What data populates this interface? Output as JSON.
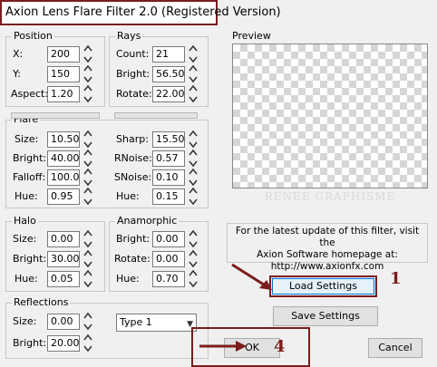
{
  "window": {
    "title": "Axion Lens Flare Filter 2.0 (Registered Version)"
  },
  "position": {
    "legend": "Position",
    "x_label": "X:",
    "x_value": "200",
    "y_label": "Y:",
    "y_value": "150",
    "aspect_label": "Aspect:",
    "aspect_value": "1.20"
  },
  "rays": {
    "legend": "Rays",
    "count_label": "Count:",
    "count_value": "21",
    "bright_label": "Bright:",
    "bright_value": "56.50",
    "rotate_label": "Rotate:",
    "rotate_value": "22.00"
  },
  "preview": {
    "legend": "Preview",
    "watermark": "RENEE GRAPHISME"
  },
  "flare": {
    "legend": "Flare",
    "size_label": "Size:",
    "size_value": "10.50",
    "bright_label": "Bright:",
    "bright_value": "40.00",
    "falloff_label": "Falloff:",
    "falloff_value": "100.00",
    "hue_label": "Hue:",
    "hue_value": "0.95",
    "sharp_label": "Sharp:",
    "sharp_value": "15.50",
    "rnoise_label": "RNoise:",
    "rnoise_value": "0.57",
    "snoise_label": "SNoise:",
    "snoise_value": "0.10",
    "hue2_label": "Hue:",
    "hue2_value": "0.15"
  },
  "halo": {
    "legend": "Halo",
    "size_label": "Size:",
    "size_value": "0.00",
    "bright_label": "Bright:",
    "bright_value": "30.00",
    "hue_label": "Hue:",
    "hue_value": "0.05"
  },
  "anamorphic": {
    "legend": "Anamorphic",
    "bright_label": "Bright:",
    "bright_value": "0.00",
    "rotate_label": "Rotate:",
    "rotate_value": "0.00",
    "hue_label": "Hue:",
    "hue_value": "0.70"
  },
  "reflections": {
    "legend": "Reflections",
    "size_label": "Size:",
    "size_value": "0.00",
    "bright_label": "Bright:",
    "bright_value": "20.00",
    "type_value": "Type 1"
  },
  "info": {
    "line1": "For the latest update of this filter, visit the",
    "line2": "Axion Software homepage at:",
    "line3": "http://www.axionfx.com"
  },
  "buttons": {
    "load_settings": "Load Settings",
    "save_settings": "Save Settings",
    "ok": "OK",
    "cancel": "Cancel"
  },
  "annotations": {
    "marker1": "1",
    "marker4": "4",
    "color": "#7a1d1a"
  }
}
